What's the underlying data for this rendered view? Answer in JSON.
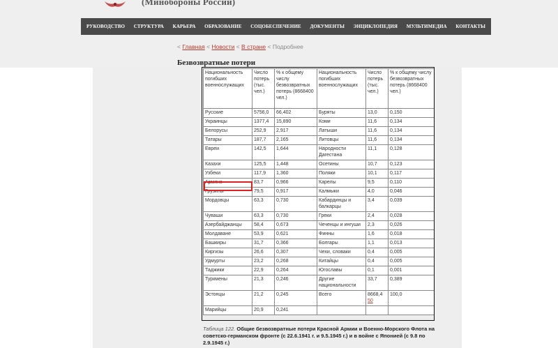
{
  "header": {
    "site_title": "(Минобороны России)",
    "emblem_icon": "eagle-emblem-icon"
  },
  "menu": [
    "РУКОВОДСТВО",
    "СТРУКТУРА",
    "КАРЬЕРА",
    "ОБРАЗОВАНИЕ",
    "СОЦОБЕСПЕЧЕНИЕ",
    "ДОКУМЕНТЫ",
    "ЭНЦИКЛОПЕДИЯ",
    "МУЛЬТИМЕДИА",
    "КОНТАКТЫ"
  ],
  "breadcrumb": {
    "sep": "<",
    "home": "Главная",
    "news": "Новости",
    "country": "В стране",
    "current": "Подробнее"
  },
  "page_title": "Безвозвратные потери",
  "table": {
    "headers": [
      "Национальность погибших военнослужащих",
      "Число потерь (тыс. чел.)",
      "% к общему числу безвозвратных потерь (8668400 чел.)",
      "Национальность погибших военнослужащих",
      "Число потерь (тыс. чел.)",
      "% к общему числу безвозвратных потерь (8668400 чел.)"
    ],
    "rows": [
      [
        "Русские",
        "5756,0",
        "66,402",
        "Буряты",
        "13,0",
        "0,150"
      ],
      [
        "Украинцы",
        "1377,4",
        "15,890",
        "Коми",
        "11,6",
        "0,134"
      ],
      [
        "Белорусы",
        "252,9",
        "2,917",
        "Латыши",
        "11,6",
        "0,134"
      ],
      [
        "Татары",
        "187,7",
        "2,165",
        "Литовцы",
        "11,6",
        "0,134"
      ],
      [
        "Евреи",
        "142,5",
        "1,644",
        "Народности Дагестана",
        "11,1",
        "0,128"
      ],
      [
        "Казахи",
        "125,5",
        "1,448",
        "Осетины",
        "10,7",
        "0,123"
      ],
      [
        "Узбеки",
        "117,9",
        "1,360",
        "Поляки",
        "10,1",
        "0,117"
      ],
      [
        "Армяне",
        "83,7",
        "0,966",
        "Карелы",
        "9,5",
        "0,110"
      ],
      [
        "Грузины",
        "79,5",
        "0,917",
        "Калмыки",
        "4,0",
        "0,046"
      ],
      [
        "Мордовцы",
        "63,3",
        "0,730",
        "Кабардинцы и балкарцы",
        "3,4",
        "0,039"
      ],
      [
        "Чуваши",
        "63,3",
        "0,730",
        "Греки",
        "2,4",
        "0,028"
      ],
      [
        "Азербайджанцы",
        "58,4",
        "0,673",
        "Чеченцы и ингуши",
        "2,3",
        "0,026"
      ],
      [
        "Молдаване",
        "53,9",
        "0,621",
        "Финны",
        "1,6",
        "0,018"
      ],
      [
        "Башкиры",
        "31,7",
        "0,366",
        "Болгары",
        "1,1",
        "0,013"
      ],
      [
        "Киргизы",
        "26,6",
        "0,307",
        "Чехи, словаки",
        "0,4",
        "0,005"
      ],
      [
        "Удмурты",
        "23,2",
        "0,268",
        "Китайцы",
        "0,4",
        "0,005"
      ],
      [
        "Таджики",
        "22,9",
        "0,264",
        "Югославы",
        "0,1",
        "0,001"
      ],
      [
        "Туркмены",
        "21,3",
        "0,246",
        "Другие национальности",
        "33,7",
        "0,389"
      ],
      [
        "Эстонцы",
        "21,2",
        "0,245",
        "Всего",
        "8668,4",
        "100,0"
      ],
      [
        "Марийцы",
        "20,9",
        "0,241",
        "",
        "",
        ""
      ]
    ],
    "total_link_suffix": "50"
  },
  "caption": {
    "label": "Таблица 122.",
    "text": "Общие безвозвратные потери Красной Армии и Военно-Морского Флота на советско-германском фронте (с 22.6.1941 г. и 9.5.1945 г.) и в войне с Японией (с 9.8 по 2.9.1945 г.)"
  },
  "colors": {
    "menu_bg": "#4a4a4a",
    "link": "#c0392b",
    "highlight": "#e02020"
  }
}
